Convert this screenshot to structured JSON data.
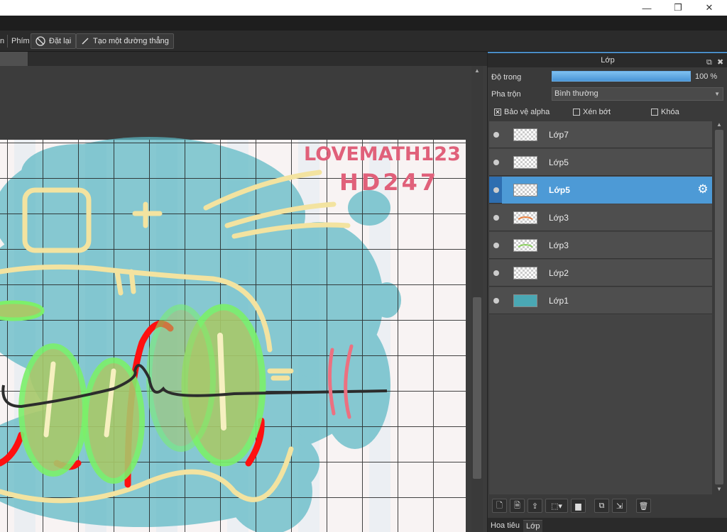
{
  "window": {
    "minimize_glyph": "—",
    "restore_glyph": "❐",
    "close_glyph": "✕"
  },
  "toolbar": {
    "partial_label": "n",
    "keys_label": "Phím",
    "reset_button": "Đặt lại",
    "straight_line_button": "Tạo một đường thẳng"
  },
  "canvas": {
    "drawing_text_line1": "LOVEMATH123",
    "drawing_text_line2": "HD247"
  },
  "layers_panel": {
    "title": "Lớp",
    "opacity_label": "Độ trong",
    "opacity_value": "100 %",
    "opacity_fraction": 1.0,
    "blend_label": "Pha trộn",
    "blend_value": "Bình thường",
    "protect_alpha_label": "Bảo vệ alpha",
    "protect_alpha_checked": true,
    "clip_label": "Xén bớt",
    "clip_checked": false,
    "lock_label": "Khóa",
    "lock_checked": false,
    "layers": [
      {
        "name": "Lớp7",
        "selected": false
      },
      {
        "name": "Lớp5",
        "selected": false
      },
      {
        "name": "Lớp5",
        "selected": true
      },
      {
        "name": "Lớp3",
        "selected": false
      },
      {
        "name": "Lớp3",
        "selected": false
      },
      {
        "name": "Lớp2",
        "selected": false
      },
      {
        "name": "Lớp1",
        "selected": false
      }
    ],
    "bottom_tabs": [
      "Hoa tiêu",
      "Lớp"
    ]
  },
  "colors": {
    "accent": "#4d9ad6",
    "panel_bg": "#3a3a3a",
    "canvas_teal": "#5bb8c4",
    "stroke_yellow": "#f3e3a0",
    "stroke_red": "#ff1010",
    "stroke_green": "#7cf06a",
    "text_pink": "#e0607a"
  }
}
